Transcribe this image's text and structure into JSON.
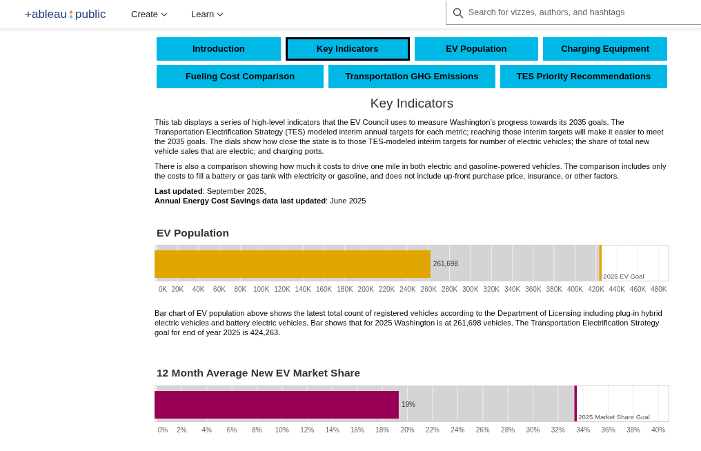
{
  "header": {
    "logo": [
      "+ableau",
      "public"
    ],
    "nav": [
      {
        "label": "Create"
      },
      {
        "label": "Learn"
      }
    ],
    "search": {
      "placeholder": "Search for vizzes, authors, and hashtags"
    }
  },
  "tabs": [
    [
      {
        "label": "Introduction",
        "selected": false
      },
      {
        "label": "Key Indicators",
        "selected": true
      },
      {
        "label": "EV Population",
        "selected": false
      },
      {
        "label": "Charging Equipment",
        "selected": false
      }
    ],
    [
      {
        "label": "Fueling Cost Comparison",
        "selected": false
      },
      {
        "label": "Transportation GHG Emissions",
        "selected": false
      },
      {
        "label": "TES Priority Recommendations",
        "selected": false
      }
    ]
  ],
  "title": "Key Indicators",
  "paragraphs": [
    "This tab displays a series of high-level indicators that the EV Council uses to measure Washington’s progress towards its 2035 goals. The Transportation Electrification Strategy (TES) modeled interim annual targets for each metric; reaching those interim targets will make it easier to meet the 2035 goals. The dials show how close the state is to those TES-modeled interim targets for number of electric vehicles; the share of total new vehicle sales that are electric; and charging ports.",
    "There is also a comparison showing how much it costs to drive one mile in both electric and gasoline-powered vehicles. The comparison includes only the costs to fill a battery or gas tank with electricity or gasoline, and does not include up-front purchase price, insurance, or other factors."
  ],
  "updates": [
    "**Last updated**: September 2025,",
    "**Annual Energy Cost Savings data last updated**: June 2025"
  ],
  "sections": [
    {
      "heading": "EV Population",
      "color": "#e2a600",
      "chart_data": {
        "type": "bar",
        "orientation": "horizontal",
        "values": [
          261698
        ],
        "value_labels": [
          "261,698"
        ],
        "xlim": [
          0,
          488000
        ],
        "xticks": [
          {
            "value": 0,
            "label": "0K"
          },
          {
            "value": 20000,
            "label": "20K"
          },
          {
            "value": 40000,
            "label": "40K"
          },
          {
            "value": 60000,
            "label": "60K"
          },
          {
            "value": 80000,
            "label": "80K"
          },
          {
            "value": 100000,
            "label": "100K"
          },
          {
            "value": 120000,
            "label": "120K"
          },
          {
            "value": 140000,
            "label": "140K"
          },
          {
            "value": 160000,
            "label": "160K"
          },
          {
            "value": 180000,
            "label": "180K"
          },
          {
            "value": 200000,
            "label": "200K"
          },
          {
            "value": 220000,
            "label": "220K"
          },
          {
            "value": 240000,
            "label": "240K"
          },
          {
            "value": 260000,
            "label": "260K"
          },
          {
            "value": 280000,
            "label": "280K"
          },
          {
            "value": 300000,
            "label": "300K"
          },
          {
            "value": 320000,
            "label": "320K"
          },
          {
            "value": 340000,
            "label": "340K"
          },
          {
            "value": 360000,
            "label": "360K"
          },
          {
            "value": 380000,
            "label": "380K"
          },
          {
            "value": 400000,
            "label": "400K"
          },
          {
            "value": 420000,
            "label": "420K"
          },
          {
            "value": 440000,
            "label": "440K"
          },
          {
            "value": 460000,
            "label": "460K"
          },
          {
            "value": 480000,
            "label": "480K"
          }
        ],
        "grid": true,
        "bands": [
          {
            "axis": "x",
            "from": 0,
            "to": 424263,
            "color": "#d4d4d4"
          }
        ],
        "ref_lines": [
          {
            "axis": "x",
            "value": 424263,
            "label": "2025 EV Goal"
          }
        ]
      },
      "caption": "Bar chart of EV population above shows the latest total count of registered vehicles according to the Department of Licensing including plug-in hybrid electric vehicles and battery electric vehicles. Bar shows that for 2025 Washington is at 261,698 vehicles. The Transportation Electrification Strategy goal for end of year 2025 is 424,263."
    },
    {
      "heading": "12 Month Average New EV Market Share",
      "color": "#990055",
      "chart_data": {
        "type": "bar",
        "orientation": "horizontal",
        "values": [
          19.3
        ],
        "value_labels": [
          "19%"
        ],
        "xlim": [
          0,
          40.7
        ],
        "xticks": [
          {
            "value": 0,
            "label": "0%"
          },
          {
            "value": 2,
            "label": "2%"
          },
          {
            "value": 4,
            "label": "4%"
          },
          {
            "value": 6,
            "label": "6%"
          },
          {
            "value": 8,
            "label": "8%"
          },
          {
            "value": 10,
            "label": "10%"
          },
          {
            "value": 12,
            "label": "12%"
          },
          {
            "value": 14,
            "label": "14%"
          },
          {
            "value": 16,
            "label": "16%"
          },
          {
            "value": 18,
            "label": "18%"
          },
          {
            "value": 20,
            "label": "20%"
          },
          {
            "value": 22,
            "label": "22%"
          },
          {
            "value": 24,
            "label": "24%"
          },
          {
            "value": 26,
            "label": "26%"
          },
          {
            "value": 28,
            "label": "28%"
          },
          {
            "value": 30,
            "label": "30%"
          },
          {
            "value": 32,
            "label": "32%"
          },
          {
            "value": 34,
            "label": "34%"
          },
          {
            "value": 36,
            "label": "36%"
          },
          {
            "value": 38,
            "label": "38%"
          },
          {
            "value": 40,
            "label": "40%"
          }
        ],
        "grid": true,
        "bands": [
          {
            "axis": "x",
            "from": 0,
            "to": 33.4,
            "color": "#d4d4d4"
          }
        ],
        "ref_lines": [
          {
            "axis": "x",
            "value": 33.4,
            "label": "2025 Market Share Goal"
          }
        ]
      }
    }
  ]
}
